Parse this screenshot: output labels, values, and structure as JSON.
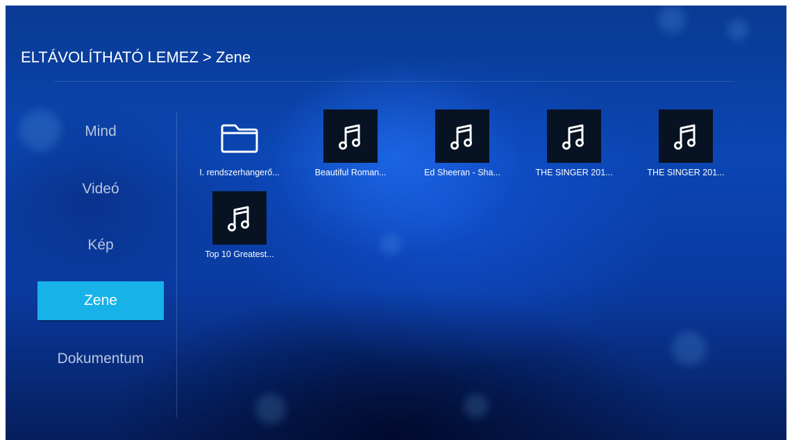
{
  "breadcrumb": "ELTÁVOLÍTHATÓ LEMEZ > Zene",
  "nav": [
    {
      "label": "Mind",
      "active": false
    },
    {
      "label": "Videó",
      "active": false
    },
    {
      "label": "Kép",
      "active": false
    },
    {
      "label": "Zene",
      "active": true
    },
    {
      "label": "Dokumentum",
      "active": false
    }
  ],
  "items": [
    {
      "type": "folder",
      "icon": "folder-icon",
      "label": "I. rendszerhangerő..."
    },
    {
      "type": "music",
      "icon": "music-note-icon",
      "label": "Beautiful Roman..."
    },
    {
      "type": "music",
      "icon": "music-note-icon",
      "label": "Ed Sheeran - Sha..."
    },
    {
      "type": "music",
      "icon": "music-note-icon",
      "label": "THE SINGER 201..."
    },
    {
      "type": "music",
      "icon": "music-note-icon",
      "label": "THE SINGER 201..."
    },
    {
      "type": "music",
      "icon": "music-note-icon",
      "label": "Top 10 Greatest..."
    }
  ],
  "colors": {
    "accent": "#17b3e8",
    "background": "#0b46b3"
  }
}
